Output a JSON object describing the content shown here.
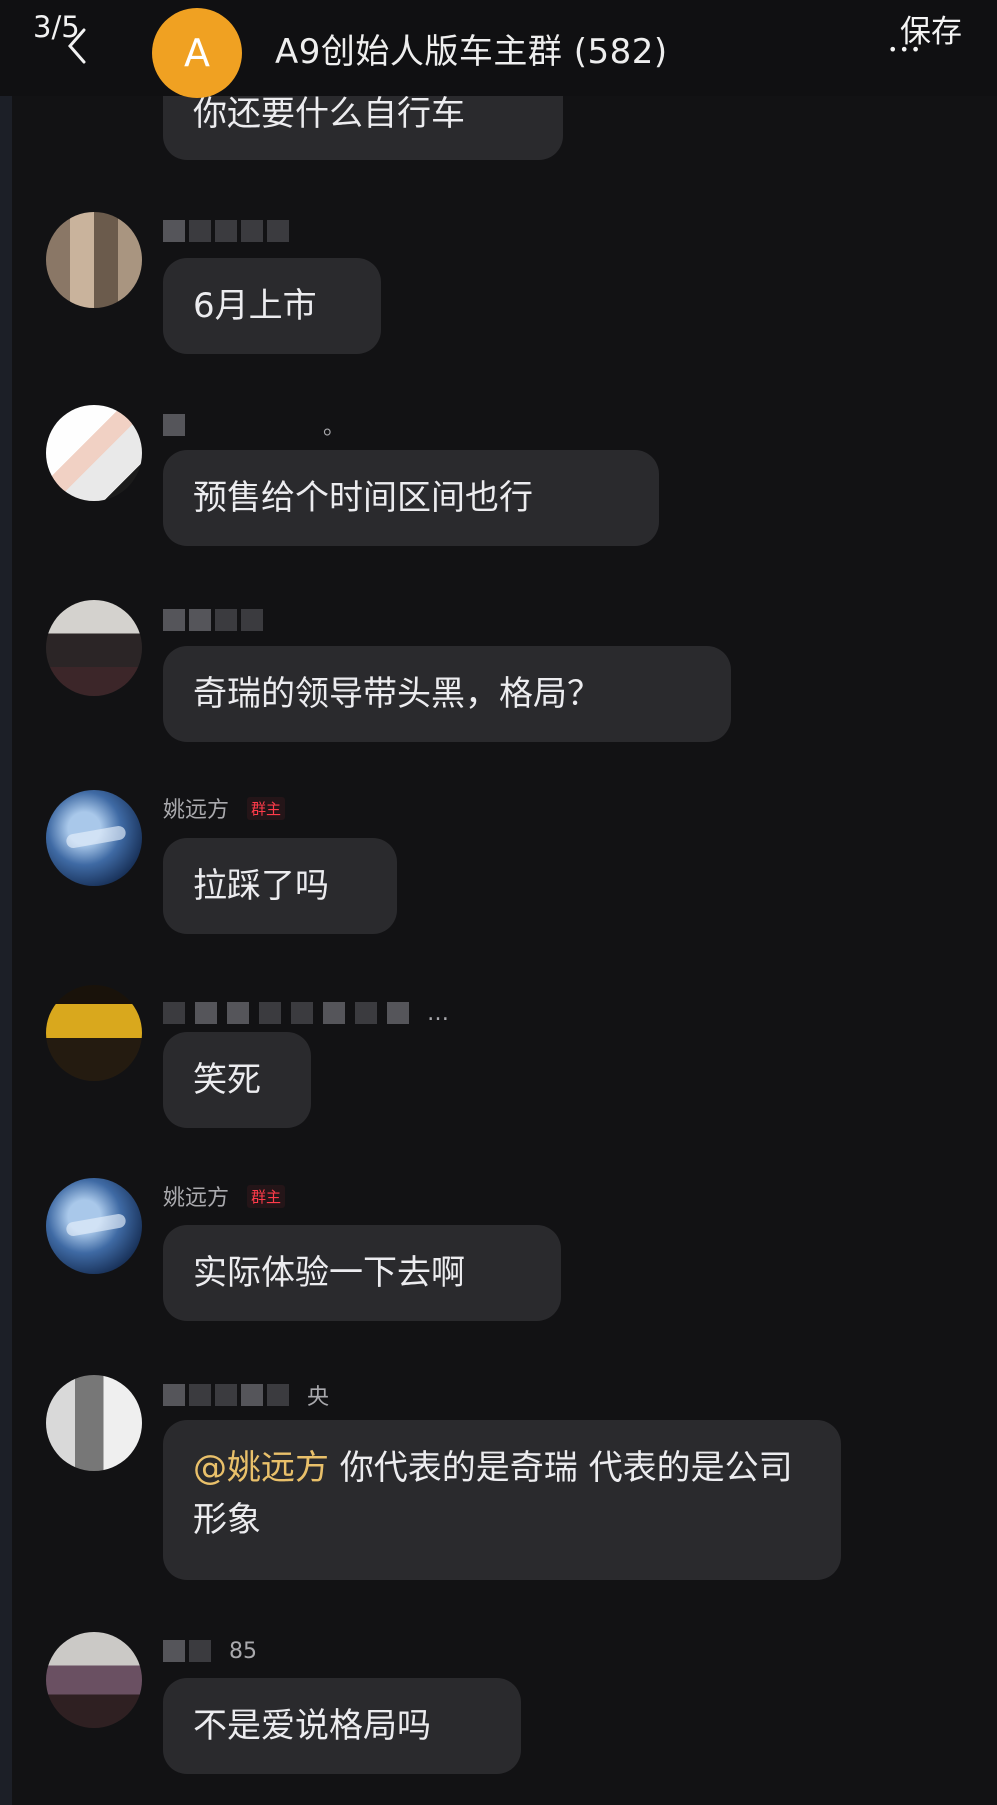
{
  "header": {
    "page_indicator": "3/5",
    "group_avatar_letter": "A",
    "group_title": "A9创始人版车主群 (582)",
    "save_label": "保存",
    "more_dots": "•••"
  },
  "messages": [
    {
      "sender": "",
      "role": "",
      "text": "你还要什么自行车"
    },
    {
      "sender": "",
      "role": "",
      "text": "6月上市"
    },
    {
      "sender": "",
      "role": "",
      "name_suffix": "。",
      "text": "预售给个时间区间也行"
    },
    {
      "sender": "",
      "role": "",
      "text": "奇瑞的领导带头黑，格局？"
    },
    {
      "sender": "姚远方",
      "role": "群主",
      "text": "拉踩了吗"
    },
    {
      "sender": "",
      "role": "",
      "name_suffix": "…",
      "text": "笑死"
    },
    {
      "sender": "姚远方",
      "role": "群主",
      "text": "实际体验一下去啊"
    },
    {
      "sender": "",
      "role": "",
      "name_suffix": "央",
      "mention": "@姚远方",
      "text": " 你代表的是奇瑞 代表的是公司形象"
    },
    {
      "sender": "",
      "role": "",
      "name_suffix": "85",
      "text": "不是爱说格局吗"
    }
  ],
  "colors": {
    "background": "#121214",
    "bubble": "#2a2a2d",
    "mention": "#e9c06a",
    "owner_badge": "#ff3b4a",
    "group_avatar": "#f0a122"
  },
  "icons": [
    "back-arrow-icon",
    "more-dots-icon"
  ]
}
